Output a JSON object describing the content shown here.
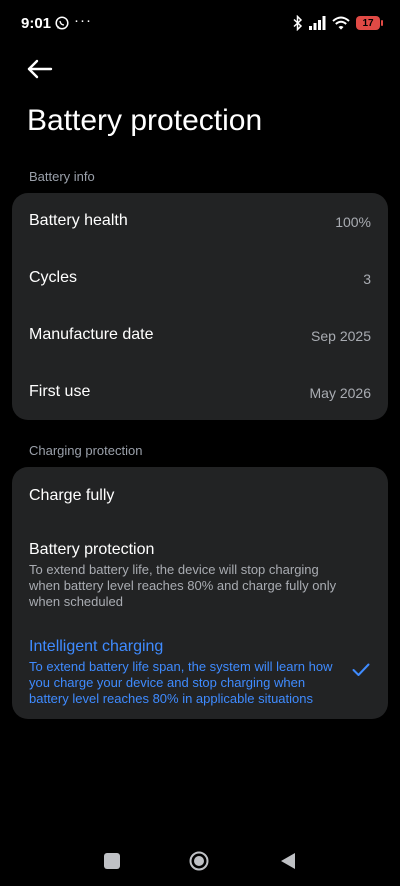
{
  "status_bar": {
    "time": "9:01",
    "dots": "···",
    "battery_level": "17",
    "icons": [
      "whatsapp-icon",
      "bluetooth-icon",
      "signal-icon",
      "wifi-icon",
      "battery-icon"
    ],
    "battery_color": "#e04a45"
  },
  "header": {
    "back_icon": "back-arrow-icon",
    "title": "Battery protection"
  },
  "battery_info": {
    "label": "Battery info",
    "rows": [
      {
        "label": "Battery health",
        "value": "100%"
      },
      {
        "label": "Cycles",
        "value": "3"
      },
      {
        "label": "Manufacture date",
        "value": "Sep 2025"
      },
      {
        "label": "First use",
        "value": "May 2026"
      }
    ]
  },
  "charging_protection": {
    "label": "Charging protection",
    "options": [
      {
        "title": "Charge fully",
        "desc": "",
        "selected": false
      },
      {
        "title": "Battery protection",
        "desc": "To extend battery life, the device will stop charging when battery level reaches 80% and charge fully only when scheduled",
        "selected": false
      },
      {
        "title": "Intelligent charging",
        "desc": "To extend battery life span, the system will learn how you charge your device and stop charging when battery level reaches 80% in applicable situations",
        "selected": true
      }
    ]
  },
  "colors": {
    "background": "#000000",
    "card": "#222324",
    "accent": "#3f8bff",
    "secondary_text": "#a9acb2"
  },
  "nav_bar": {
    "icons": [
      "recents-icon",
      "home-icon",
      "back-icon"
    ]
  }
}
